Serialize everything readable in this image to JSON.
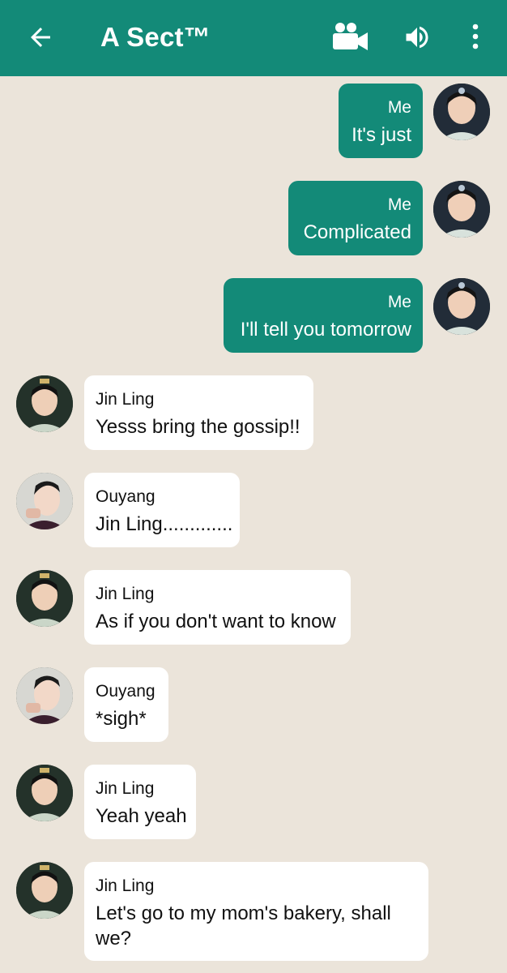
{
  "header": {
    "title": "A Sect™",
    "back_icon": "arrow-left-icon",
    "video_icon": "video-camera-icon",
    "volume_icon": "speaker-icon",
    "menu_icon": "more-vertical-icon",
    "background_color": "#138a78"
  },
  "chat": {
    "background_color": "#ebe4da",
    "outgoing_bubble_color": "#138a78",
    "incoming_bubble_color": "#ffffff",
    "messages": [
      {
        "sender": "Me",
        "text": "It's just",
        "direction": "outgoing"
      },
      {
        "sender": "Me",
        "text": "Complicated",
        "direction": "outgoing"
      },
      {
        "sender": "Me",
        "text": "I'll tell you tomorrow",
        "direction": "outgoing"
      },
      {
        "sender": "Jin Ling",
        "text": "Yesss bring the gossip!!",
        "direction": "incoming"
      },
      {
        "sender": "Ouyang",
        "text": "Jin Ling.............",
        "direction": "incoming"
      },
      {
        "sender": "Jin Ling",
        "text": "As if you don't want to know",
        "direction": "incoming"
      },
      {
        "sender": "Ouyang",
        "text": "*sigh*",
        "direction": "incoming"
      },
      {
        "sender": "Jin Ling",
        "text": "Yeah yeah",
        "direction": "incoming"
      },
      {
        "sender": "Jin Ling",
        "text": "Let's go to my mom's bakery, shall we?",
        "direction": "incoming"
      }
    ]
  }
}
